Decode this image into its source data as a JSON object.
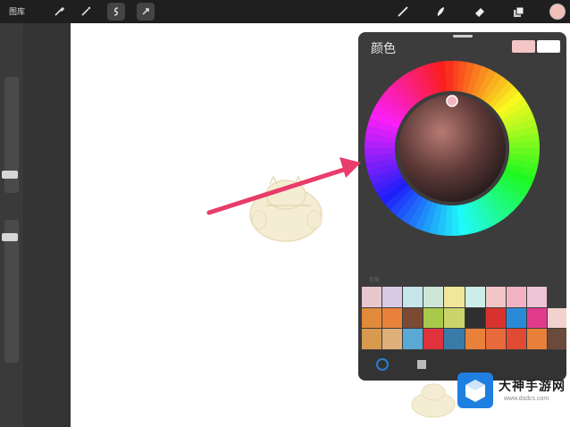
{
  "toolbar": {
    "gallery_label": "图库",
    "left_icons": [
      "wrench-icon",
      "magic-wand-icon",
      "selection-icon",
      "transform-icon"
    ],
    "right_icons": [
      "brush-icon",
      "smudge-icon",
      "eraser-icon",
      "layers-icon"
    ],
    "current_color": "#f2c0b8"
  },
  "panel": {
    "title": "颜色",
    "primary_color": "#f4c6c6",
    "secondary_color": "#ffffff",
    "recent_label": "色板",
    "swatches": [
      "#e9c7cf",
      "#d9cbe6",
      "#c6e6ea",
      "#cfe6d6",
      "#f0e79a",
      "#cdeee8",
      "#f2c5c7",
      "#f3b2c4",
      "#eec4d6",
      "#3c3c3c",
      "#e08a3a",
      "#e8823a",
      "#7a4a32",
      "#a8c94a",
      "#cbd46a",
      "#2f2f2f",
      "#d8322e",
      "#2b8ad8",
      "#e03b8c",
      "#f1d2cf",
      "#d89a4e",
      "#dfb07a",
      "#5aa8d4",
      "#e0323a",
      "#3a7aa8",
      "#e8823a",
      "#e86a3a",
      "#e04a32",
      "#e8803a",
      "#6a4a3a"
    ]
  },
  "watermark": {
    "title": "大神手游网",
    "url": "www.dsdcs.com"
  }
}
